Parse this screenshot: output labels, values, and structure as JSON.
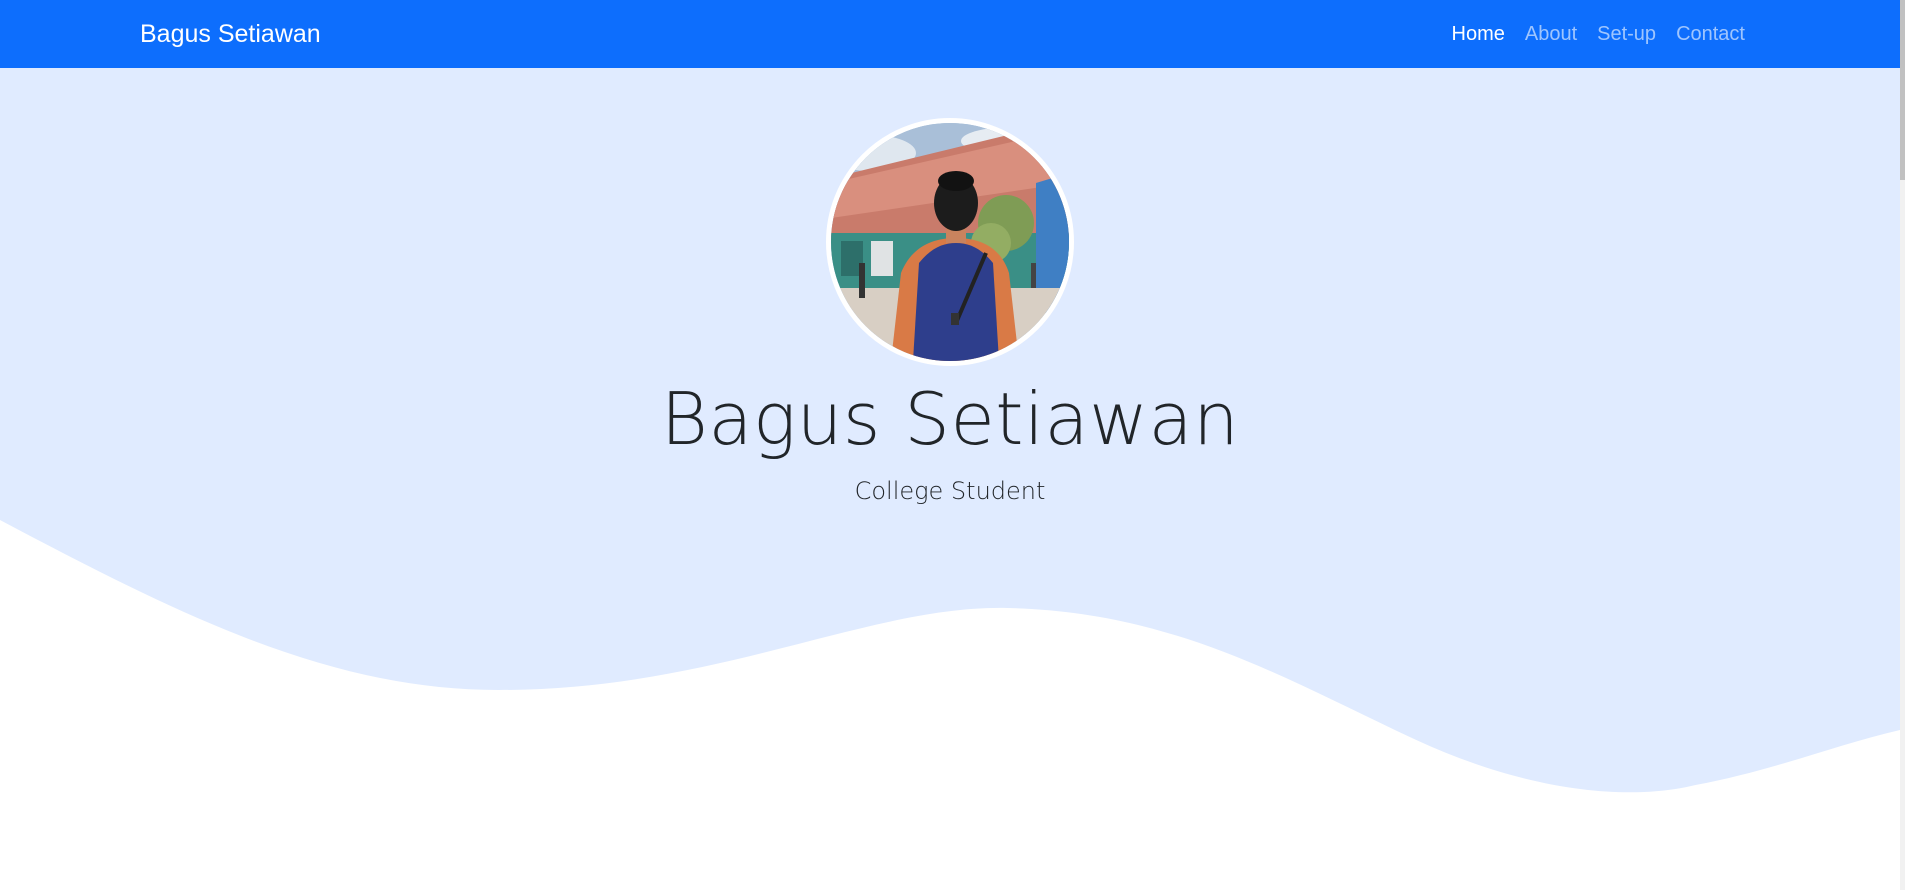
{
  "navbar": {
    "brand": "Bagus Setiawan",
    "links": [
      {
        "label": "Home",
        "active": true
      },
      {
        "label": "About",
        "active": false
      },
      {
        "label": "Set-up",
        "active": false
      },
      {
        "label": "Contact",
        "active": false
      }
    ]
  },
  "hero": {
    "name": "Bagus Setiawan",
    "role": "College Student"
  },
  "colors": {
    "navbar": "#0d6efd",
    "hero_background": "#e0ebff",
    "text": "#212529"
  },
  "icons": {
    "avatar": "profile-photo"
  }
}
